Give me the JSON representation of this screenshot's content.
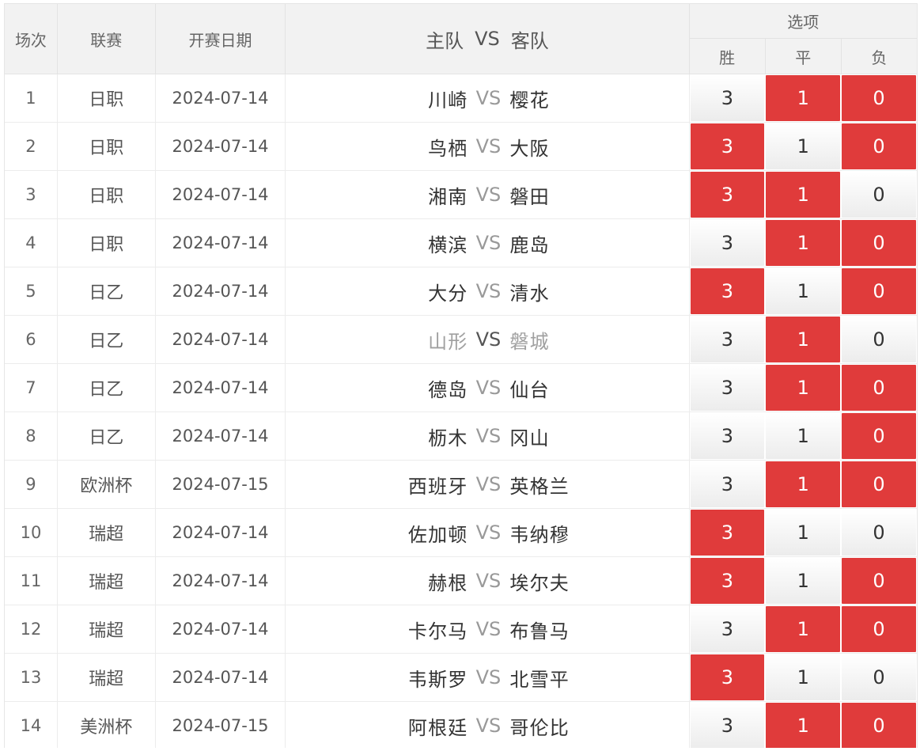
{
  "header": {
    "col_index": "场次",
    "col_league": "联赛",
    "col_date": "开赛日期",
    "col_home": "主队",
    "col_vs": "VS",
    "col_away": "客队",
    "col_options": "选项",
    "opt_win": "胜",
    "opt_draw": "平",
    "opt_lose": "负"
  },
  "vs_label": "VS",
  "rows": [
    {
      "index": "1",
      "league": "日职",
      "date": "2024-07-14",
      "home": "川崎",
      "away": "樱花",
      "win": "3",
      "draw": "1",
      "lose": "0",
      "selected": [
        false,
        true,
        true
      ],
      "dim": false
    },
    {
      "index": "2",
      "league": "日职",
      "date": "2024-07-14",
      "home": "鸟栖",
      "away": "大阪",
      "win": "3",
      "draw": "1",
      "lose": "0",
      "selected": [
        true,
        false,
        true
      ],
      "dim": false
    },
    {
      "index": "3",
      "league": "日职",
      "date": "2024-07-14",
      "home": "湘南",
      "away": "磐田",
      "win": "3",
      "draw": "1",
      "lose": "0",
      "selected": [
        true,
        true,
        false
      ],
      "dim": false
    },
    {
      "index": "4",
      "league": "日职",
      "date": "2024-07-14",
      "home": "横滨",
      "away": "鹿岛",
      "win": "3",
      "draw": "1",
      "lose": "0",
      "selected": [
        false,
        true,
        true
      ],
      "dim": false
    },
    {
      "index": "5",
      "league": "日乙",
      "date": "2024-07-14",
      "home": "大分",
      "away": "清水",
      "win": "3",
      "draw": "1",
      "lose": "0",
      "selected": [
        true,
        false,
        true
      ],
      "dim": false
    },
    {
      "index": "6",
      "league": "日乙",
      "date": "2024-07-14",
      "home": "山形",
      "away": "磐城",
      "win": "3",
      "draw": "1",
      "lose": "0",
      "selected": [
        false,
        true,
        false
      ],
      "dim": true
    },
    {
      "index": "7",
      "league": "日乙",
      "date": "2024-07-14",
      "home": "德岛",
      "away": "仙台",
      "win": "3",
      "draw": "1",
      "lose": "0",
      "selected": [
        false,
        true,
        true
      ],
      "dim": false
    },
    {
      "index": "8",
      "league": "日乙",
      "date": "2024-07-14",
      "home": "枥木",
      "away": "冈山",
      "win": "3",
      "draw": "1",
      "lose": "0",
      "selected": [
        false,
        false,
        true
      ],
      "dim": false
    },
    {
      "index": "9",
      "league": "欧洲杯",
      "date": "2024-07-15",
      "home": "西班牙",
      "away": "英格兰",
      "win": "3",
      "draw": "1",
      "lose": "0",
      "selected": [
        false,
        true,
        true
      ],
      "dim": false
    },
    {
      "index": "10",
      "league": "瑞超",
      "date": "2024-07-14",
      "home": "佐加顿",
      "away": "韦纳穆",
      "win": "3",
      "draw": "1",
      "lose": "0",
      "selected": [
        true,
        false,
        false
      ],
      "dim": false
    },
    {
      "index": "11",
      "league": "瑞超",
      "date": "2024-07-14",
      "home": "赫根",
      "away": "埃尔夫",
      "win": "3",
      "draw": "1",
      "lose": "0",
      "selected": [
        true,
        false,
        true
      ],
      "dim": false
    },
    {
      "index": "12",
      "league": "瑞超",
      "date": "2024-07-14",
      "home": "卡尔马",
      "away": "布鲁马",
      "win": "3",
      "draw": "1",
      "lose": "0",
      "selected": [
        false,
        true,
        true
      ],
      "dim": false
    },
    {
      "index": "13",
      "league": "瑞超",
      "date": "2024-07-14",
      "home": "韦斯罗",
      "away": "北雪平",
      "win": "3",
      "draw": "1",
      "lose": "0",
      "selected": [
        true,
        false,
        false
      ],
      "dim": false
    },
    {
      "index": "14",
      "league": "美洲杯",
      "date": "2024-07-15",
      "home": "阿根廷",
      "away": "哥伦比",
      "win": "3",
      "draw": "1",
      "lose": "0",
      "selected": [
        false,
        true,
        true
      ],
      "dim": false
    }
  ],
  "colors": {
    "selected_bg": "#e03b3b",
    "header_bg": "#f2f2f2"
  }
}
